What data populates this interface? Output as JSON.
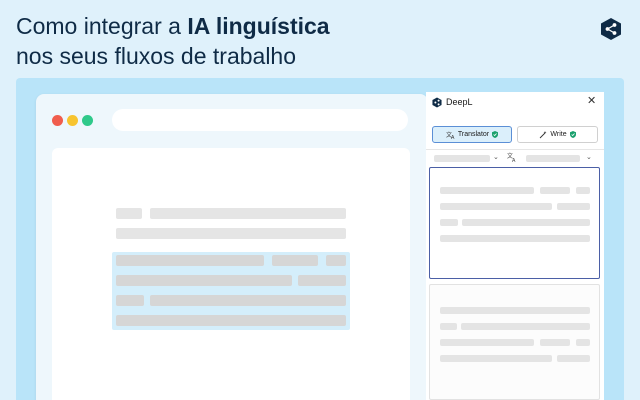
{
  "headline": {
    "line1_prefix": "Como integrar a ",
    "line1_bold": "IA linguística",
    "line2": "nos seus fluxos de trabalho"
  },
  "browser": {
    "traffic_lights": [
      "#f05d4d",
      "#f7c42f",
      "#2fc98a"
    ]
  },
  "panel": {
    "brand": "DeepL",
    "close": "✕",
    "tabs": [
      {
        "label": "Translator",
        "icon": "translate-icon",
        "active": true
      },
      {
        "label": "Write",
        "icon": "magic-wand-icon",
        "active": false
      }
    ]
  },
  "colors": {
    "background": "#dff1fb",
    "stage": "#b9e4f9",
    "headline": "#0f2b46",
    "brand_navy": "#0f2b46",
    "active_tab_border": "#5b8fd6",
    "verified_green": "#1aa06d",
    "highlight": "#d4eefb"
  }
}
